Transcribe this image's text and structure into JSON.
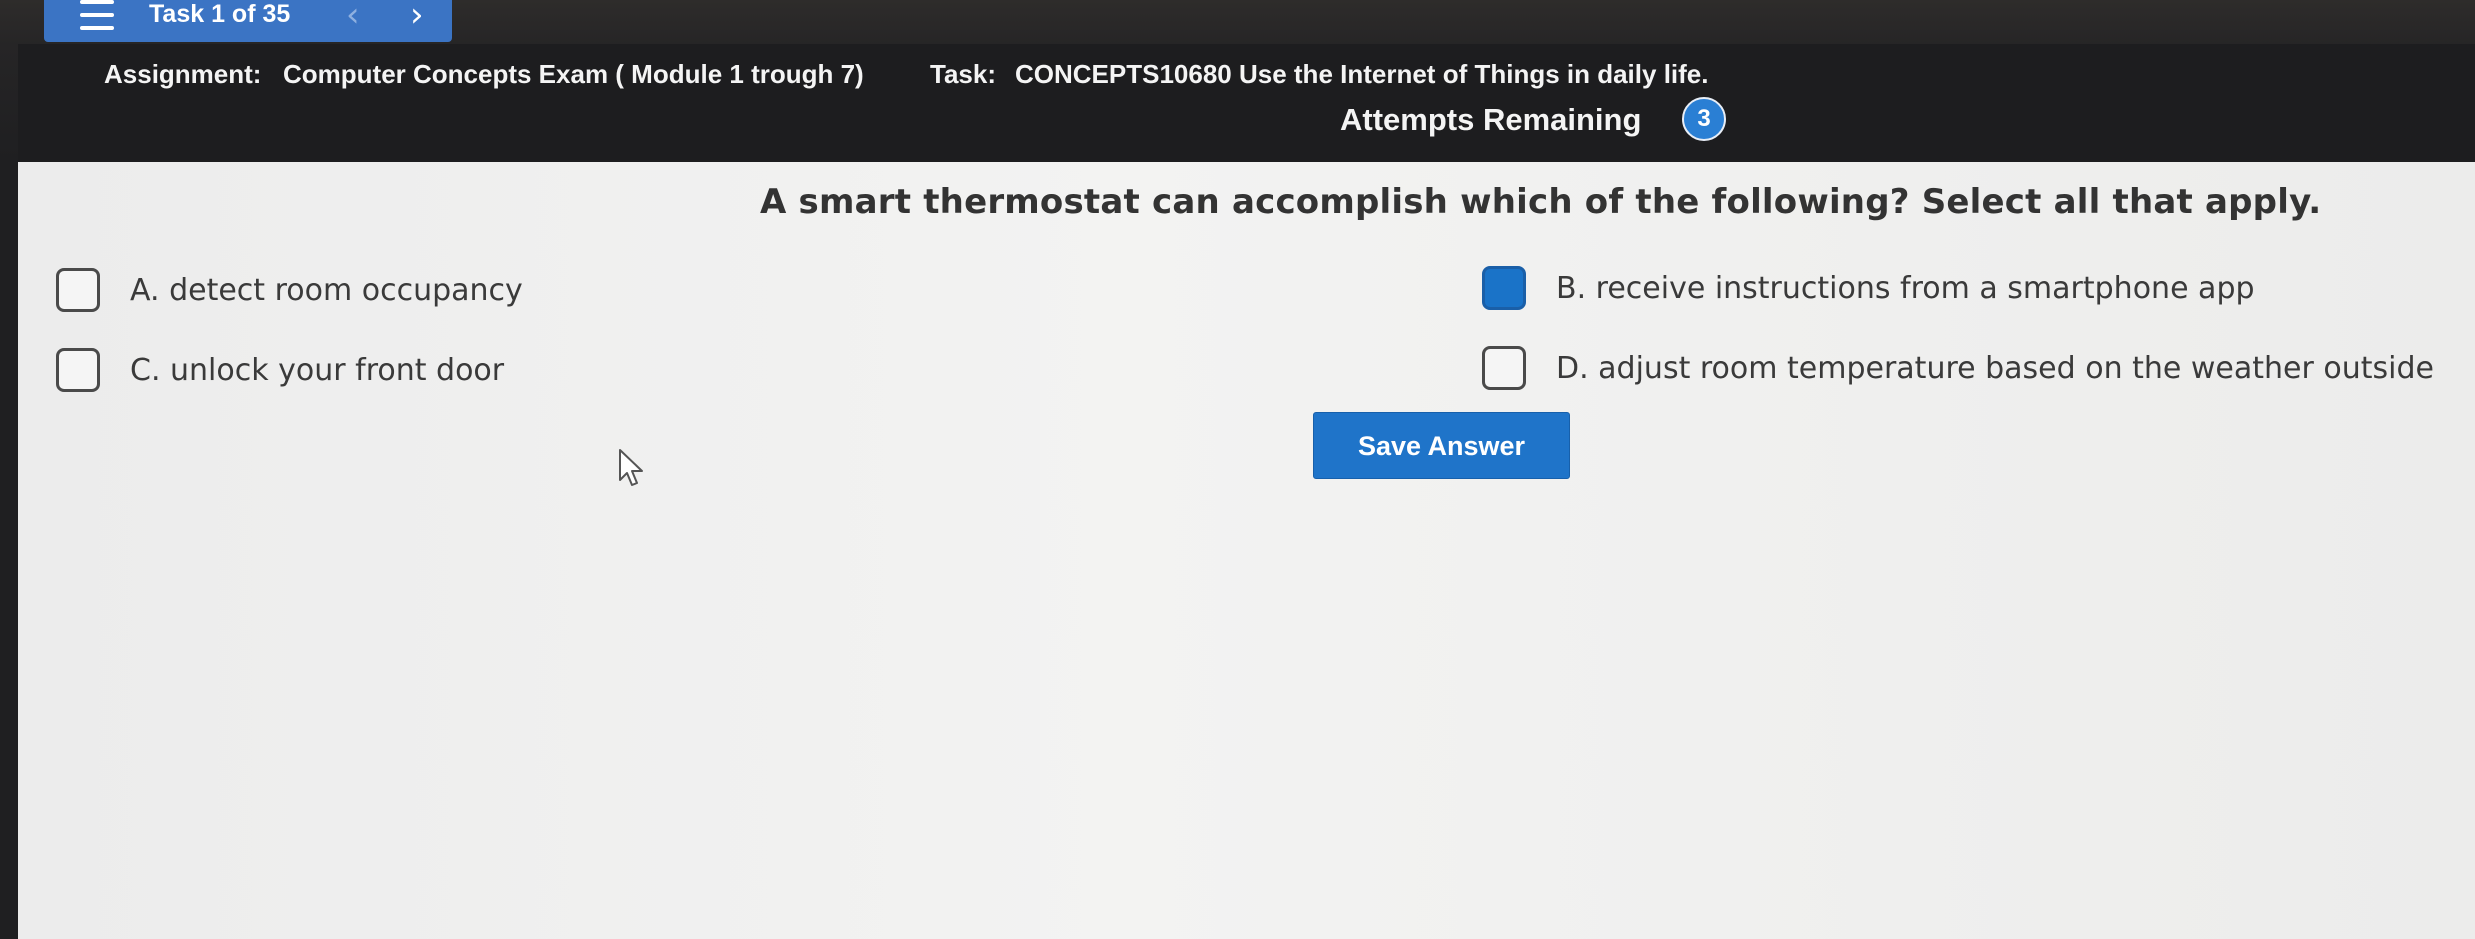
{
  "taskbar": {
    "counter": "Task 1 of 35",
    "prev_icon": "chevron-left-icon",
    "next_icon": "chevron-right-icon",
    "menu_icon": "hamburger-menu-icon",
    "color": "#3b74c4"
  },
  "header": {
    "assignment_label": "Assignment:",
    "assignment_value": "Computer Concepts Exam ( Module 1 trough 7)",
    "task_label": "Task:",
    "task_value": "CONCEPTS10680 Use the Internet of Things in daily life.",
    "attempts_label": "Attempts Remaining",
    "attempts_count": "3"
  },
  "question": {
    "text": "A smart thermostat can accomplish which of the following? Select all that apply.",
    "options": [
      {
        "label": "A. detect room occupancy",
        "checked": false
      },
      {
        "label": "B. receive instructions from a smartphone app",
        "checked": true
      },
      {
        "label": "C. unlock your front door",
        "checked": false
      },
      {
        "label": "D. adjust room temperature based on the weather outside",
        "checked": false
      }
    ]
  },
  "actions": {
    "save_label": "Save Answer",
    "accent": "#1f74c9"
  }
}
